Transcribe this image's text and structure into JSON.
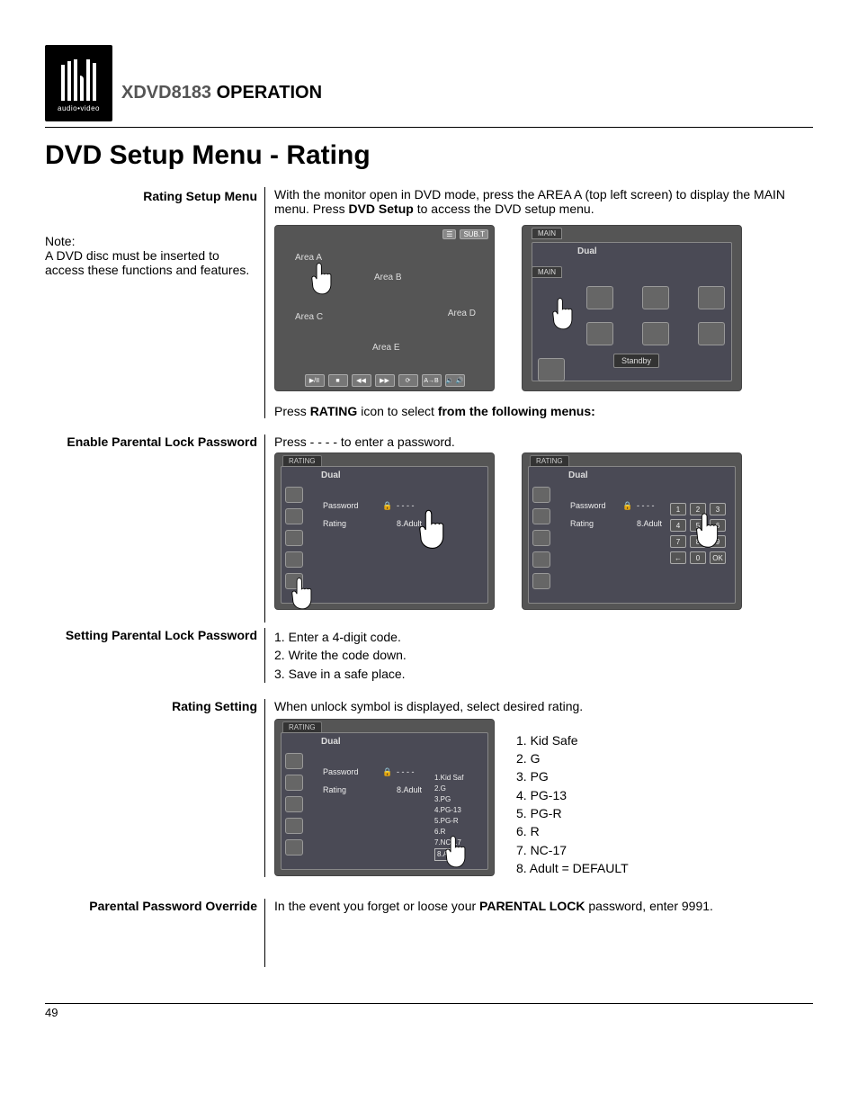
{
  "logo_sub": "audio•video",
  "model": "XDVD8183",
  "operation": "OPERATION",
  "title": "DVD Setup Menu - Rating",
  "s1_label": "Rating Setup Menu",
  "s1_body_a": "With the monitor open in DVD mode, press the AREA A (top left screen) to display the MAIN menu. Press ",
  "s1_body_b": "DVD Setup",
  "s1_body_c": " to access the DVD setup menu.",
  "note_head": "Note:",
  "note_body": "A DVD disc must be inserted to access these functions and features.",
  "scr1": {
    "areaA": "Area A",
    "areaB": "Area B",
    "areaC": "Area C",
    "areaD": "Area D",
    "areaE": "Area E",
    "subt": "SUB.T",
    "bb": [
      "▶/II",
      "■",
      "◀◀",
      "▶▶",
      "⟳",
      "A→B",
      "🔉 🔊"
    ]
  },
  "scr2": {
    "tab": "MAIN",
    "tab2": "MAIN",
    "brand": "Dual",
    "standby": "Standby"
  },
  "press_rating_a": "Press ",
  "press_rating_b": "RATING",
  "press_rating_c": " icon to select ",
  "press_rating_d": "from the following menus:",
  "s2_label": "Enable Parental Lock Password",
  "s2_body": "Press - - - - to enter a password.",
  "scr_rating": {
    "tab": "RATING",
    "brand": "Dual",
    "pw": "Password",
    "pwval": "- - - -",
    "rt": "Rating",
    "rtval": "8.Adult",
    "keys": [
      "1",
      "2",
      "3",
      "4",
      "5",
      "6",
      "7",
      "8",
      "9",
      "←",
      "0",
      "OK"
    ]
  },
  "s3_label": "Setting Parental Lock Password",
  "s3_steps": [
    "1. Enter a 4-digit code.",
    "2. Write the code down.",
    "3. Save in a safe place."
  ],
  "s4_label": "Rating Setting",
  "s4_body": "When unlock symbol is displayed, select desired rating.",
  "scr_rlist": [
    "1.Kid Saf",
    "2.G",
    "3.PG",
    "4.PG-13",
    "5.PG-R",
    "6.R",
    "7.NC-17",
    "8.Adult"
  ],
  "ratings": [
    "1. Kid Safe",
    "2. G",
    "3. PG",
    "4. PG-13",
    "5. PG-R",
    "6. R",
    "7. NC-17",
    "8. Adult = DEFAULT"
  ],
  "s5_label": "Parental Password Override",
  "s5_a": "In the event you forget or loose your ",
  "s5_b": "PARENTAL LOCK",
  "s5_c": " password, enter 9991.",
  "page": "49"
}
